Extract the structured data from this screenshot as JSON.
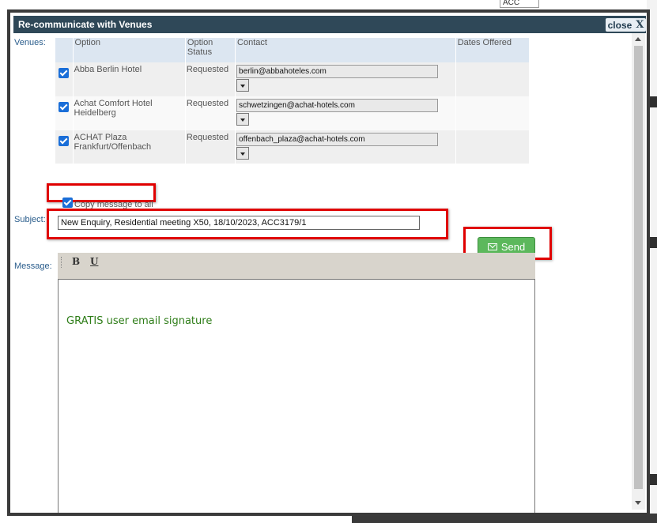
{
  "background": {
    "select_text": "ACC"
  },
  "dialog": {
    "title": "Re-communicate with Venues",
    "close_label": "close",
    "close_glyph": "X"
  },
  "labels": {
    "venues": "Venues:",
    "subject": "Subject:",
    "message": "Message:"
  },
  "table": {
    "headers": {
      "option": "Option",
      "status": "Option Status",
      "contact": "Contact",
      "dates": "Dates Offered"
    },
    "rows": [
      {
        "checked": true,
        "option": "Abba Berlin Hotel",
        "status": "Requested",
        "email": "berlin@abbahoteles.com",
        "dates": ""
      },
      {
        "checked": true,
        "option": "Achat Comfort Hotel Heidelberg",
        "status": "Requested",
        "email": "schwetzingen@achat-hotels.com",
        "dates": ""
      },
      {
        "checked": true,
        "option": "ACHAT Plaza Frankfurt/Offenbach",
        "status": "Requested",
        "email": "offenbach_plaza@achat-hotels.com",
        "dates": ""
      }
    ]
  },
  "copy_all": {
    "checked": true,
    "label": "Copy message to all"
  },
  "subject": {
    "value": "New Enquiry, Residential meeting X50, 18/10/2023, ACC3179/1"
  },
  "send": {
    "label": "Send",
    "icon": "envelope-icon",
    "color": "#5cb85c"
  },
  "editor": {
    "toolbar": {
      "bold": "B",
      "underline": "U"
    },
    "signature": "GRATIS user email signature",
    "signature_color": "#2e7d18"
  },
  "colors": {
    "titlebar": "#2f4858",
    "highlight": "#e00000",
    "table_header": "#dce6f1"
  }
}
